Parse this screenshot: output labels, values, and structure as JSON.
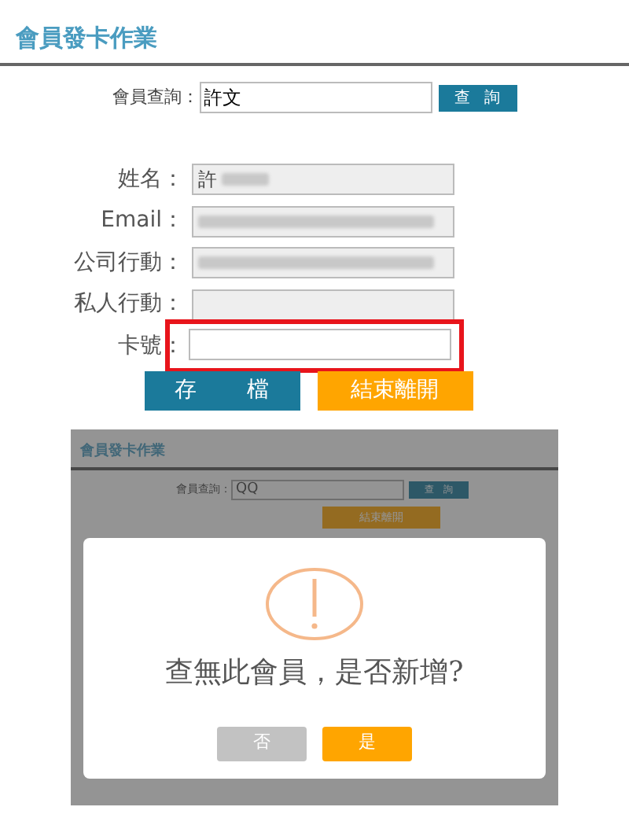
{
  "title": "會員發卡作業",
  "query": {
    "label": "會員查詢：",
    "value": "許文",
    "button": "查 詢"
  },
  "fields": [
    {
      "label": "姓名：",
      "value": "許",
      "redacted": true,
      "disabled": true,
      "highlighted": false
    },
    {
      "label": "Email：",
      "redacted": true,
      "disabled": true,
      "highlighted": false
    },
    {
      "label": "公司行動：",
      "redacted": true,
      "disabled": true,
      "highlighted": false
    },
    {
      "label": "私人行動：",
      "redacted": false,
      "disabled": true,
      "highlighted": false
    },
    {
      "label": "卡號：",
      "redacted": false,
      "disabled": false,
      "highlighted": true
    }
  ],
  "buttons": [
    {
      "label": "存 檔",
      "kind": "primary"
    },
    {
      "label": "結束離開",
      "kind": "warning"
    }
  ],
  "embedded": {
    "title": "會員發卡作業",
    "query": {
      "label": "會員查詢：",
      "value": "QQ",
      "button": "查 詢"
    },
    "button": "結束離開",
    "dialog": {
      "message": "查無此會員，是否新增?",
      "buttons": [
        {
          "label": "否",
          "kind": "cancel"
        },
        {
          "label": "是",
          "kind": "confirm"
        }
      ]
    }
  }
}
